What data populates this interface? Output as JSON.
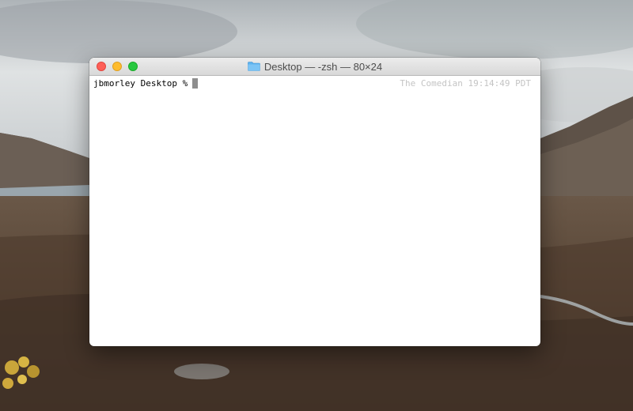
{
  "window": {
    "title": "Desktop — -zsh — 80×24",
    "folder_icon": "folder-icon"
  },
  "terminal": {
    "prompt": "jbmorley Desktop %",
    "right_prompt": "The Comedian 19:14:49 PDT"
  },
  "colors": {
    "close": "#fe5f57",
    "minimize": "#febc2e",
    "zoom": "#28c840",
    "folder": "#5eb3ef"
  }
}
